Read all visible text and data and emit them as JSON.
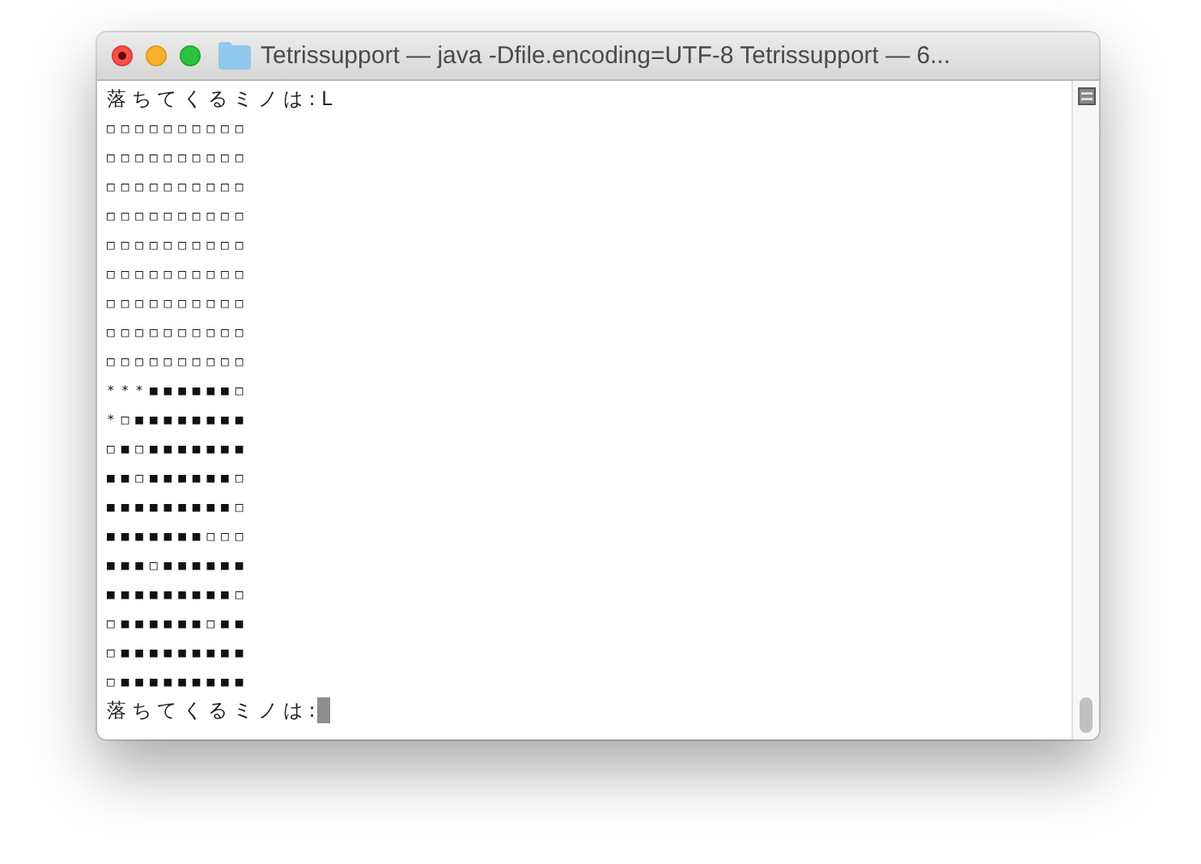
{
  "window": {
    "title": "Tetrissupport — java -Dfile.encoding=UTF-8 Tetrissupport — 6..."
  },
  "terminal": {
    "lines": [
      {
        "kind": "prompt",
        "text": "落ちてくるミノは:L"
      },
      {
        "kind": "board",
        "text": "□□□□□□□□□□"
      },
      {
        "kind": "board",
        "text": "□□□□□□□□□□"
      },
      {
        "kind": "board",
        "text": "□□□□□□□□□□"
      },
      {
        "kind": "board",
        "text": "□□□□□□□□□□"
      },
      {
        "kind": "board",
        "text": "□□□□□□□□□□"
      },
      {
        "kind": "board",
        "text": "□□□□□□□□□□"
      },
      {
        "kind": "board",
        "text": "□□□□□□□□□□"
      },
      {
        "kind": "board",
        "text": "□□□□□□□□□□"
      },
      {
        "kind": "board",
        "text": "□□□□□□□□□□"
      },
      {
        "kind": "board",
        "text": "***■■■■■■□"
      },
      {
        "kind": "board",
        "text": "*□■■■■■■■■"
      },
      {
        "kind": "board",
        "text": "□■□■■■■■■■"
      },
      {
        "kind": "board",
        "text": "■■□■■■■■■□"
      },
      {
        "kind": "board",
        "text": "■■■■■■■■■□"
      },
      {
        "kind": "board",
        "text": "■■■■■■■□□□"
      },
      {
        "kind": "board",
        "text": "■■■□■■■■■■"
      },
      {
        "kind": "board",
        "text": "■■■■■■■■■□"
      },
      {
        "kind": "board",
        "text": "□■■■■■■□■■"
      },
      {
        "kind": "board",
        "text": "□■■■■■■■■■"
      },
      {
        "kind": "board",
        "text": "□■■■■■■■■■"
      },
      {
        "kind": "prompt",
        "text": "落ちてくるミノは:"
      }
    ],
    "cursor": true
  }
}
